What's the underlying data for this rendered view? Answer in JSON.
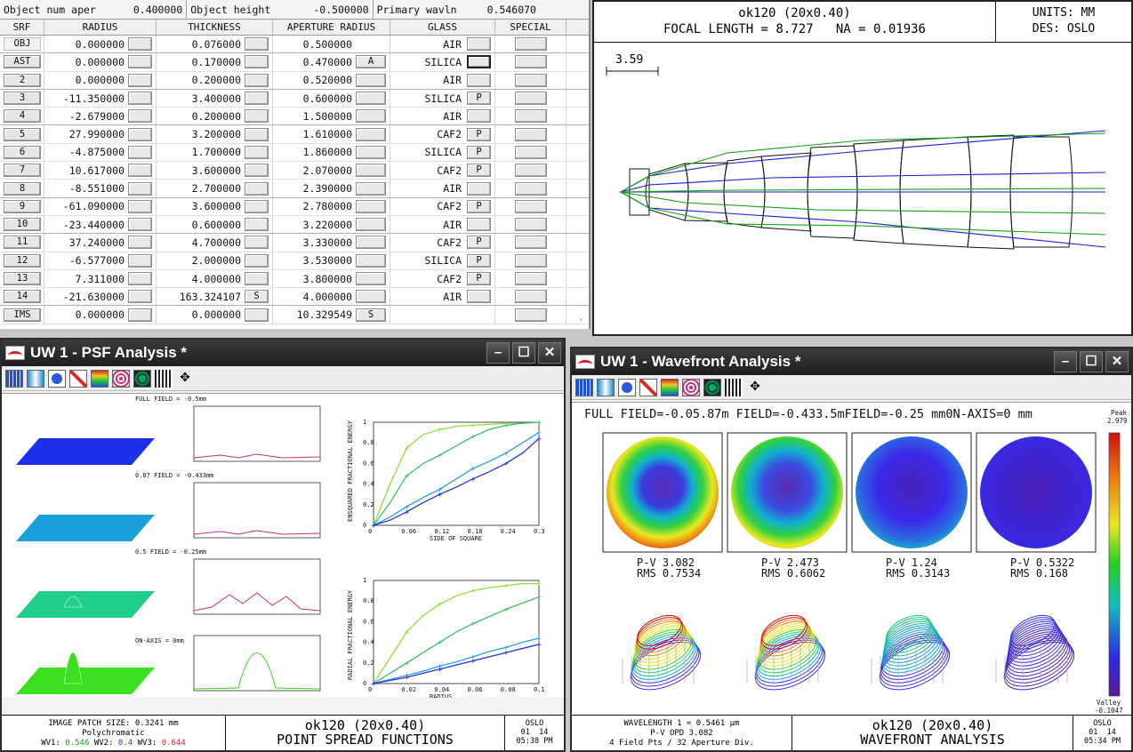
{
  "lens_editor": {
    "header": {
      "object_num_aper_label": "Object num aper",
      "object_num_aper_value": "0.400000",
      "object_height_label": "Object height",
      "object_height_value": "-0.500000",
      "primary_wavln_label": "Primary wavln",
      "primary_wavln_value": "0.546070"
    },
    "columns": {
      "srf": "SRF",
      "radius": "RADIUS",
      "thickness": "THICKNESS",
      "aperture": "APERTURE RADIUS",
      "glass": "GLASS",
      "special": "SPECIAL"
    },
    "rows": [
      {
        "srf": "OBJ",
        "radius": "0.000000",
        "thickness": "0.076000",
        "thk_flag": "",
        "aperture": "0.500000",
        "ap_flag": "",
        "ap_btn": false,
        "glass": "AIR",
        "gl_flag": ""
      },
      {
        "srf": "AST",
        "radius": "0.000000",
        "thickness": "0.170000",
        "thk_flag": "",
        "aperture": "0.470000",
        "ap_flag": "A",
        "ap_btn": true,
        "glass": "SILICA",
        "gl_flag": ""
      },
      {
        "srf": "2",
        "radius": "0.000000",
        "thickness": "0.200000",
        "thk_flag": "",
        "aperture": "0.520000",
        "ap_flag": "",
        "ap_btn": true,
        "glass": "AIR",
        "gl_flag": ""
      },
      {
        "srf": "3",
        "radius": "-11.350000",
        "thickness": "3.400000",
        "thk_flag": "",
        "aperture": "0.600000",
        "ap_flag": "",
        "ap_btn": true,
        "glass": "SILICA",
        "gl_flag": "P"
      },
      {
        "srf": "4",
        "radius": "-2.679000",
        "thickness": "0.200000",
        "thk_flag": "",
        "aperture": "1.500000",
        "ap_flag": "",
        "ap_btn": true,
        "glass": "AIR",
        "gl_flag": ""
      },
      {
        "srf": "5",
        "radius": "27.990000",
        "thickness": "3.200000",
        "thk_flag": "",
        "aperture": "1.610000",
        "ap_flag": "",
        "ap_btn": true,
        "glass": "CAF2",
        "gl_flag": "P"
      },
      {
        "srf": "6",
        "radius": "-4.875000",
        "thickness": "1.700000",
        "thk_flag": "",
        "aperture": "1.860000",
        "ap_flag": "",
        "ap_btn": true,
        "glass": "SILICA",
        "gl_flag": "P"
      },
      {
        "srf": "7",
        "radius": "10.617000",
        "thickness": "3.600000",
        "thk_flag": "",
        "aperture": "2.070000",
        "ap_flag": "",
        "ap_btn": true,
        "glass": "CAF2",
        "gl_flag": "P"
      },
      {
        "srf": "8",
        "radius": "-8.551000",
        "thickness": "2.700000",
        "thk_flag": "",
        "aperture": "2.390000",
        "ap_flag": "",
        "ap_btn": true,
        "glass": "AIR",
        "gl_flag": ""
      },
      {
        "srf": "9",
        "radius": "-61.090000",
        "thickness": "3.600000",
        "thk_flag": "",
        "aperture": "2.780000",
        "ap_flag": "",
        "ap_btn": true,
        "glass": "CAF2",
        "gl_flag": "P"
      },
      {
        "srf": "10",
        "radius": "-23.440000",
        "thickness": "0.600000",
        "thk_flag": "",
        "aperture": "3.220000",
        "ap_flag": "",
        "ap_btn": true,
        "glass": "AIR",
        "gl_flag": ""
      },
      {
        "srf": "11",
        "radius": "37.240000",
        "thickness": "4.700000",
        "thk_flag": "",
        "aperture": "3.330000",
        "ap_flag": "",
        "ap_btn": true,
        "glass": "CAF2",
        "gl_flag": "P"
      },
      {
        "srf": "12",
        "radius": "-6.577000",
        "thickness": "2.000000",
        "thk_flag": "",
        "aperture": "3.530000",
        "ap_flag": "",
        "ap_btn": true,
        "glass": "SILICA",
        "gl_flag": "P"
      },
      {
        "srf": "13",
        "radius": "7.311000",
        "thickness": "4.000000",
        "thk_flag": "",
        "aperture": "3.800000",
        "ap_flag": "",
        "ap_btn": true,
        "glass": "CAF2",
        "gl_flag": "P"
      },
      {
        "srf": "14",
        "radius": "-21.630000",
        "thickness": "163.324107",
        "thk_flag": "S",
        "aperture": "4.000000",
        "ap_flag": "",
        "ap_btn": true,
        "glass": "AIR",
        "gl_flag": ""
      },
      {
        "srf": "IMS",
        "radius": "0.000000",
        "thickness": "0.000000",
        "thk_flag": "",
        "aperture": "10.329549",
        "ap_flag": "S",
        "ap_btn": true,
        "glass": "",
        "gl_flag": ""
      }
    ]
  },
  "lens_drawing": {
    "title": "ok120 (20x0.40)",
    "subtitle": "FOCAL LENGTH = 8.727   NA = 0.01936",
    "units": "UNITS: MM",
    "design": "DES: OSLO",
    "scale": "3.59",
    "ray_colors": {
      "axial": "#1a1ad0",
      "field": "#12a012"
    }
  },
  "psf_window": {
    "title": "UW 1 - PSF Analysis *",
    "fields": [
      {
        "label": "FULL FIELD = -0.5mm",
        "color": "#1a2fe6"
      },
      {
        "label": "0.87 FIELD = -0.433mm",
        "color": "#1aa0d8"
      },
      {
        "label": "0.5 FIELD = -0.25mm",
        "color": "#20d08a"
      },
      {
        "label": "ON-AXIS = 0mm",
        "color": "#3de020"
      }
    ],
    "ensquared_ylabel": "ENSQUARED FRACTIONAL ENERGY",
    "ensquared_xlabel": "SIDE OF SQUARE",
    "ensquared_xticks": [
      "0",
      "0.06",
      "0.12",
      "0.18",
      "0.24",
      "0.3"
    ],
    "radial_ylabel": "RADIAL FRACTIONAL ENERGY",
    "radial_xlabel": "RADIUS",
    "radial_xticks": [
      "0",
      "0.02",
      "0.04",
      "0.06",
      "0.08",
      "0.1"
    ],
    "yticks": [
      "0",
      "0.2",
      "0.4",
      "0.6",
      "0.8",
      "1"
    ],
    "footer": {
      "patch": "IMAGE PATCH SIZE: 0.3241 mm",
      "mode": "Polychromatic",
      "wv1_label": "WV1:",
      "wv1_value": "0.546",
      "wv2_label": "WV2:",
      "wv2_value": "0.4",
      "wv3_label": "WV3:",
      "wv3_value": "0.644",
      "title": "ok120 (20x0.40)",
      "subtitle": "POINT SPREAD FUNCTIONS",
      "brand": "OSLO",
      "date": "01  14",
      "time": "05:38 PM"
    }
  },
  "wavefront_window": {
    "title": "UW 1 - Wavefront Analysis *",
    "header_text": "FULL FIELD=-0.05.87m FIELD=-0.433.5mFIELD=-0.25 mm0N-AXIS=0 mm",
    "peak_label": "Peak",
    "peak_value": "2.979",
    "valley_label": "Valley",
    "valley_value": "-0.1047",
    "maps": [
      {
        "pv": "P-V 3.082",
        "rms": "RMS 0.7534"
      },
      {
        "pv": "P-V 2.473",
        "rms": "RMS 0.6062"
      },
      {
        "pv": "P-V 1.24",
        "rms": "RMS 0.3143"
      },
      {
        "pv": "P-V 0.5322",
        "rms": "RMS 0.168"
      }
    ],
    "footer": {
      "wavelength": "WAVELENGTH 1 = 0.5461 µm",
      "pv_opd": "P-V OPD 3.082",
      "pts": "4 Field Pts / 32 Aperture Div.",
      "title": "ok120 (20x0.40)",
      "subtitle": "WAVEFRONT ANALYSIS",
      "brand": "OSLO",
      "date": "01  14",
      "time": "05:34 PM"
    }
  },
  "chart_data": [
    {
      "type": "line",
      "title": "",
      "xlabel": "SIDE OF SQUARE",
      "ylabel": "ENSQUARED FRACTIONAL ENERGY",
      "xlim": [
        0,
        0.3
      ],
      "ylim": [
        0,
        1
      ],
      "x": [
        0,
        0.03,
        0.06,
        0.09,
        0.12,
        0.15,
        0.18,
        0.21,
        0.24,
        0.27,
        0.3
      ],
      "series": [
        {
          "values": [
            0,
            0.4,
            0.75,
            0.88,
            0.93,
            0.96,
            0.97,
            0.98,
            0.99,
            0.99,
            1.0
          ],
          "color": "#8ee03a"
        },
        {
          "values": [
            0,
            0.22,
            0.48,
            0.6,
            0.68,
            0.77,
            0.86,
            0.93,
            0.97,
            0.99,
            1.0
          ],
          "color": "#3bbf6a"
        },
        {
          "values": [
            0,
            0.08,
            0.18,
            0.27,
            0.35,
            0.45,
            0.55,
            0.62,
            0.7,
            0.8,
            0.9
          ],
          "color": "#2aa0d8"
        },
        {
          "values": [
            0,
            0.05,
            0.13,
            0.22,
            0.3,
            0.37,
            0.45,
            0.52,
            0.6,
            0.7,
            0.84
          ],
          "color": "#2233dd"
        }
      ]
    },
    {
      "type": "line",
      "title": "",
      "xlabel": "RADIUS",
      "ylabel": "RADIAL FRACTIONAL ENERGY",
      "xlim": [
        0,
        0.1
      ],
      "ylim": [
        0,
        1
      ],
      "x": [
        0,
        0.01,
        0.02,
        0.03,
        0.04,
        0.05,
        0.06,
        0.07,
        0.08,
        0.09,
        0.1
      ],
      "series": [
        {
          "values": [
            0,
            0.25,
            0.5,
            0.66,
            0.77,
            0.85,
            0.9,
            0.93,
            0.95,
            0.97,
            0.97
          ],
          "color": "#8ee03a"
        },
        {
          "values": [
            0,
            0.1,
            0.2,
            0.3,
            0.4,
            0.5,
            0.58,
            0.65,
            0.72,
            0.78,
            0.84
          ],
          "color": "#3bbf6a"
        },
        {
          "values": [
            0,
            0.04,
            0.08,
            0.12,
            0.17,
            0.21,
            0.26,
            0.31,
            0.35,
            0.4,
            0.44
          ],
          "color": "#2aa0d8"
        },
        {
          "values": [
            0,
            0.03,
            0.06,
            0.1,
            0.14,
            0.18,
            0.22,
            0.26,
            0.3,
            0.34,
            0.38
          ],
          "color": "#2233dd"
        }
      ]
    }
  ]
}
